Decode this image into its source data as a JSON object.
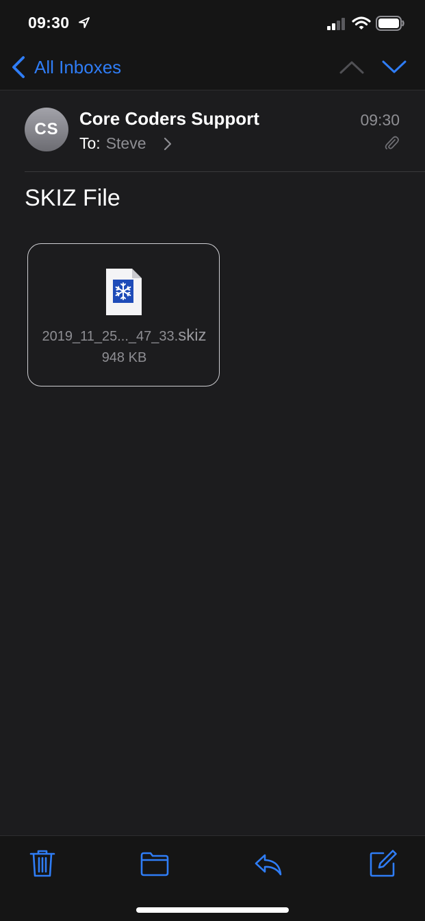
{
  "status_bar": {
    "time": "09:30"
  },
  "nav": {
    "back_label": "All Inboxes"
  },
  "message": {
    "avatar_initials": "CS",
    "sender": "Core Coders Support",
    "to_label": "To:",
    "recipient": "Steve",
    "time": "09:30",
    "subject": "SKIZ File"
  },
  "attachment": {
    "name_prefix": "2019_11_25..._47_33.",
    "extension": "skiz",
    "size": "948 KB"
  },
  "colors": {
    "accent": "#2f7df6",
    "background": "#1c1c1e",
    "bar_background": "#151515",
    "secondary_text": "#8e8e93",
    "file_icon_blue": "#1e4bb8"
  },
  "icons": {
    "status": [
      "location-arrow-icon",
      "cellular-signal-icon",
      "wifi-icon",
      "battery-icon"
    ],
    "nav": [
      "chevron-left-icon",
      "chevron-up-icon",
      "chevron-down-icon"
    ],
    "toolbar": [
      "trash-icon",
      "folder-icon",
      "reply-icon",
      "compose-icon"
    ]
  }
}
